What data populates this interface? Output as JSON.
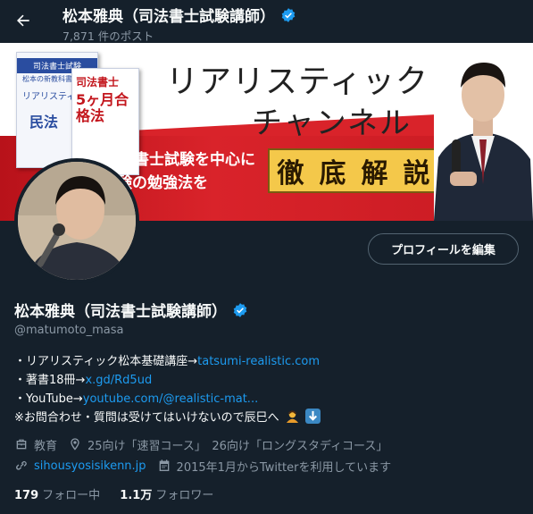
{
  "header": {
    "title": "松本雅典（司法書士試験講師）",
    "post_count": "7,871 件のポスト",
    "back_icon": "arrow-left-icon"
  },
  "banner": {
    "title_line1": "リアリスティック",
    "title_line2": "チャンネル",
    "subtitle_line1": "司法書士試験を中心に",
    "subtitle_line2": "資格試験の勉強法を",
    "highlight_chars": [
      "徹",
      "底",
      "解",
      "説"
    ],
    "book1_header": "司法書士試験",
    "book1_line1": "松本の新教科書",
    "book1_line2": "リアリスティック",
    "book1_big": "民法",
    "book2_header": "司法書士",
    "book2_big": "5ヶ月合格法",
    "colors": {
      "red": "#d9232a",
      "gold": "#f4c84a"
    }
  },
  "profile": {
    "edit_button": "プロフィールを編集",
    "name": "松本雅典（司法書士試験講師）",
    "handle": "@matumoto_masa",
    "verified_color": "#1d9bf0"
  },
  "bio": {
    "line1_text": "・リアリスティック松本基礎講座→",
    "line1_link": "tatsumi-realistic.com",
    "line2_text": "・著書18冊→",
    "line2_link": "x.gd/Rd5ud",
    "line3_text": "・YouTube→",
    "line3_link": "youtube.com/@realistic-mat...",
    "line4_text": "※お問合わせ・質問は受けてはいけないので辰巳へ"
  },
  "meta": {
    "category": "教育",
    "location": "25向け「速習コース」　26向け「ロングスタディコース」",
    "website": "sihousyosisikenn.jp",
    "joined": "2015年1月からTwitterを利用しています"
  },
  "stats": {
    "following_count": "179",
    "following_label": "フォロー中",
    "followers_count": "1.1万",
    "followers_label": "フォロワー"
  }
}
